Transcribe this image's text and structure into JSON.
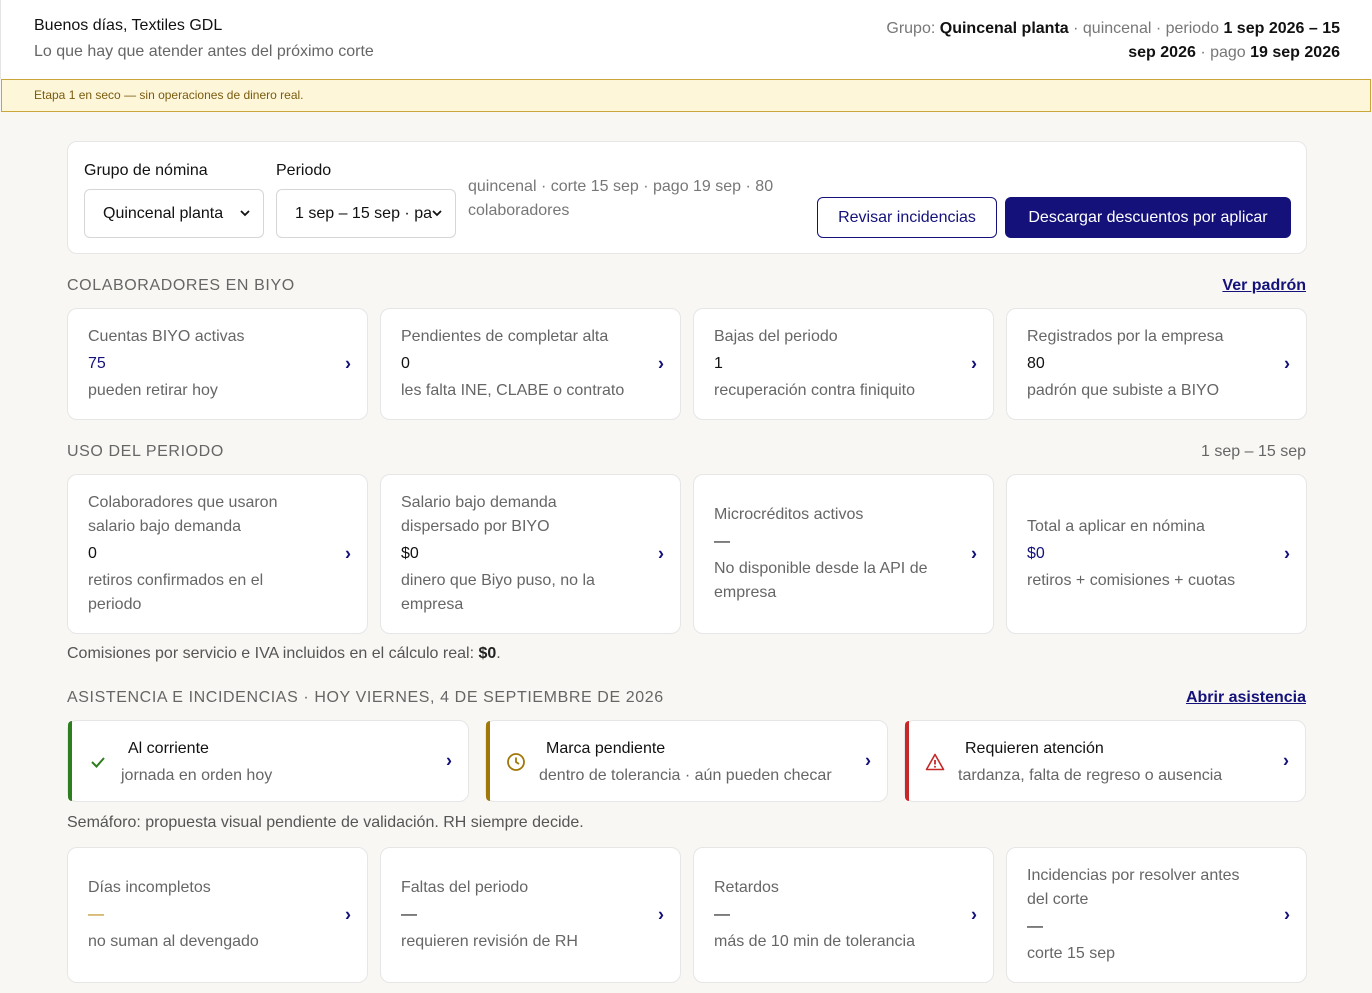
{
  "header": {
    "greeting": "Buenos días, Textiles GDL",
    "subtitle": "Lo que hay que atender antes del próximo corte",
    "group_prefix": "Grupo:",
    "group_name": "Quincenal planta",
    "sep1": "· quincenal · periodo",
    "period": "1 sep 2026 – 15 sep 2026",
    "sep2": "· pago",
    "pay_date": "19 sep 2026"
  },
  "banner": "Etapa 1 en seco — sin operaciones de dinero real.",
  "filters": {
    "group_label": "Grupo de nómina",
    "group_value": "Quincenal planta",
    "period_label": "Periodo",
    "period_value": "1 sep – 15 sep · pa",
    "meta": "quincenal · corte 15 sep · pago 19 sep · 80 colaboradores",
    "review_button": "Revisar incidencias",
    "download_button": "Descargar descuentos por aplicar"
  },
  "colaboradores": {
    "title": "COLABORADORES EN BIYO",
    "link": "Ver padrón",
    "cards": [
      {
        "title": "Cuentas BIYO activas",
        "value": "75",
        "desc": "pueden retirar hoy"
      },
      {
        "title": "Pendientes de completar alta",
        "value": "0",
        "desc": "les falta INE, CLABE o contrato"
      },
      {
        "title": "Bajas del periodo",
        "value": "1",
        "desc": "recuperación contra finiquito"
      },
      {
        "title": "Registrados por la empresa",
        "value": "80",
        "desc": "padrón que subiste a BIYO"
      }
    ]
  },
  "uso": {
    "title": "USO DEL PERIODO",
    "range": "1 sep – 15 sep",
    "cards": [
      {
        "title": "Colaboradores que usaron salario bajo demanda",
        "value": "0",
        "desc": "retiros confirmados en el periodo"
      },
      {
        "title": "Salario bajo demanda dispersado por BIYO",
        "value": "$0",
        "desc": "dinero que Biyo puso, no la empresa"
      },
      {
        "title": "Microcréditos activos",
        "value": "—",
        "desc": "No disponible desde la API de empresa"
      },
      {
        "title": "Total a aplicar en nómina",
        "value": "$0",
        "desc": "retiros + comisiones + cuotas"
      }
    ],
    "note_text": "Comisiones por servicio e IVA incluidos en el cálculo real:",
    "note_value": "$0",
    "note_end": "."
  },
  "asistencia": {
    "title": "ASISTENCIA E INCIDENCIAS · HOY VIERNES, 4 DE SEPTIEMBRE DE 2026",
    "link": "Abrir asistencia",
    "status": [
      {
        "title": "Al corriente",
        "desc": "jornada en orden hoy",
        "color": "#2e7d1e",
        "icon": "check-icon"
      },
      {
        "title": "Marca pendiente",
        "desc": "dentro de tolerancia · aún pueden checar",
        "color": "#a0780a",
        "icon": "clock-icon"
      },
      {
        "title": "Requieren atención",
        "desc": "tardanza, falta de regreso o ausencia",
        "color": "#c62828",
        "icon": "warning-icon"
      }
    ],
    "note": "Semáforo: propuesta visual pendiente de validación. RH siempre decide.",
    "cards": [
      {
        "title": "Días incompletos",
        "value": "—",
        "desc": "no suman al devengado"
      },
      {
        "title": "Faltas del periodo",
        "value": "—",
        "desc": "requieren revisión de RH"
      },
      {
        "title": "Retardos",
        "value": "—",
        "desc": "más de 10 min de tolerancia"
      },
      {
        "title": "Incidencias por resolver antes del corte",
        "value": "—",
        "desc": "corte 15 sep"
      }
    ]
  },
  "colors": {
    "primary": "#14127a",
    "banner_bg": "#fdf6d8",
    "banner_border": "#c9a53a"
  }
}
